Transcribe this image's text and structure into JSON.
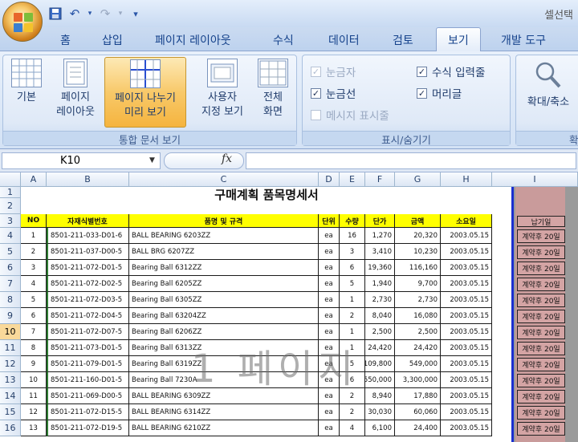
{
  "app": {
    "title": "셀선택"
  },
  "qat": {
    "save": "save-icon",
    "undo": "↶",
    "redo": "↷",
    "customize": "▾"
  },
  "tabs": [
    "홈",
    "삽입",
    "페이지 레이아웃",
    "수식",
    "데이터",
    "검토",
    "보기",
    "개발 도구"
  ],
  "active_tab": "보기",
  "ribbon": {
    "workbook_views": {
      "label": "통합 문서 보기",
      "buttons": [
        {
          "line1": "기본",
          "line2": ""
        },
        {
          "line1": "페이지",
          "line2": "레이아웃"
        },
        {
          "line1": "페이지 나누기",
          "line2": "미리 보기"
        },
        {
          "line1": "사용자",
          "line2": "지정 보기"
        },
        {
          "line1": "전체",
          "line2": "화면"
        }
      ]
    },
    "show_hide": {
      "label": "표시/숨기기",
      "items": [
        {
          "text": "눈금자",
          "checked": true,
          "disabled": true
        },
        {
          "text": "수식 입력줄",
          "checked": true,
          "disabled": false
        },
        {
          "text": "눈금선",
          "checked": true,
          "disabled": false
        },
        {
          "text": "머리글",
          "checked": true,
          "disabled": false
        },
        {
          "text": "메시지 표시줄",
          "checked": false,
          "disabled": true
        }
      ]
    },
    "zoom": {
      "label": "확",
      "button": "확대/축소"
    }
  },
  "formula_bar": {
    "name_box": "K10",
    "fx": "fx",
    "formula": ""
  },
  "columns": [
    "A",
    "B",
    "C",
    "D",
    "E",
    "F",
    "G",
    "H",
    "I"
  ],
  "rows": [
    "1",
    "2",
    "3",
    "4",
    "5",
    "6",
    "7",
    "8",
    "9",
    "10",
    "11",
    "12",
    "13",
    "14",
    "15",
    "16"
  ],
  "active_row": "10",
  "sheet": {
    "title": "구매계획 품목명세서",
    "headers": [
      "NO",
      "자재식별번호",
      "품명 및 규격",
      "단위",
      "수량",
      "단가",
      "금액",
      "소요일",
      "납기일"
    ],
    "items": [
      [
        "1",
        "8501-211-033-D01-6",
        "BALL BEARING          6203ZZ",
        "ea",
        "16",
        "1,270",
        "20,320",
        "2003.05.15",
        "계약후 20일"
      ],
      [
        "2",
        "8501-211-037-D00-5",
        "BALL BRG 6207ZZ",
        "ea",
        "3",
        "3,410",
        "10,230",
        "2003.05.15",
        "계약후 20일"
      ],
      [
        "3",
        "8501-211-072-D01-5",
        "Bearing Ball 6312ZZ",
        "ea",
        "6",
        "19,360",
        "116,160",
        "2003.05.15",
        "계약후 20일"
      ],
      [
        "4",
        "8501-211-072-D02-5",
        "Bearing Ball 6205ZZ",
        "ea",
        "5",
        "1,940",
        "9,700",
        "2003.05.15",
        "계약후 20일"
      ],
      [
        "5",
        "8501-211-072-D03-5",
        "Bearing Ball 6305ZZ",
        "ea",
        "1",
        "2,730",
        "2,730",
        "2003.05.15",
        "계약후 20일"
      ],
      [
        "6",
        "8501-211-072-D04-5",
        "Bearing Ball 63204ZZ",
        "ea",
        "2",
        "8,040",
        "16,080",
        "2003.05.15",
        "계약후 20일"
      ],
      [
        "7",
        "8501-211-072-D07-5",
        "Bearing Ball 6206ZZ",
        "ea",
        "1",
        "2,500",
        "2,500",
        "2003.05.15",
        "계약후 20일"
      ],
      [
        "8",
        "8501-211-073-D01-5",
        "Bearing Ball 6313ZZ",
        "ea",
        "1",
        "24,420",
        "24,420",
        "2003.05.15",
        "계약후 20일"
      ],
      [
        "9",
        "8501-211-079-D01-5",
        "Bearing Ball 6319ZZ",
        "ea",
        "5",
        "109,800",
        "549,000",
        "2003.05.15",
        "계약후 20일"
      ],
      [
        "10",
        "8501-211-160-D01-5",
        "Bearing  Ball 7230A",
        "ea",
        "6",
        "550,000",
        "3,300,000",
        "2003.05.15",
        "계약후 20일"
      ],
      [
        "11",
        "8501-211-069-D00-5",
        "BALL BEARING 6309ZZ",
        "ea",
        "2",
        "8,940",
        "17,880",
        "2003.05.15",
        "계약후 20일"
      ],
      [
        "12",
        "8501-211-072-D15-5",
        "BALL BEARING 6314ZZ",
        "ea",
        "2",
        "30,030",
        "60,060",
        "2003.05.15",
        "계약후 20일"
      ],
      [
        "13",
        "8501-211-072-D19-5",
        "BALL BEARING 6210ZZ",
        "ea",
        "4",
        "6,100",
        "24,400",
        "2003.05.15",
        "계약후 20일"
      ]
    ]
  },
  "page_watermark": "1 페이지",
  "colors": {
    "header_fill": "#ffff00",
    "page_break_line": "#1a2fd0",
    "outside_area": "#9a9a9a",
    "selected_button": "#f8c96a"
  }
}
